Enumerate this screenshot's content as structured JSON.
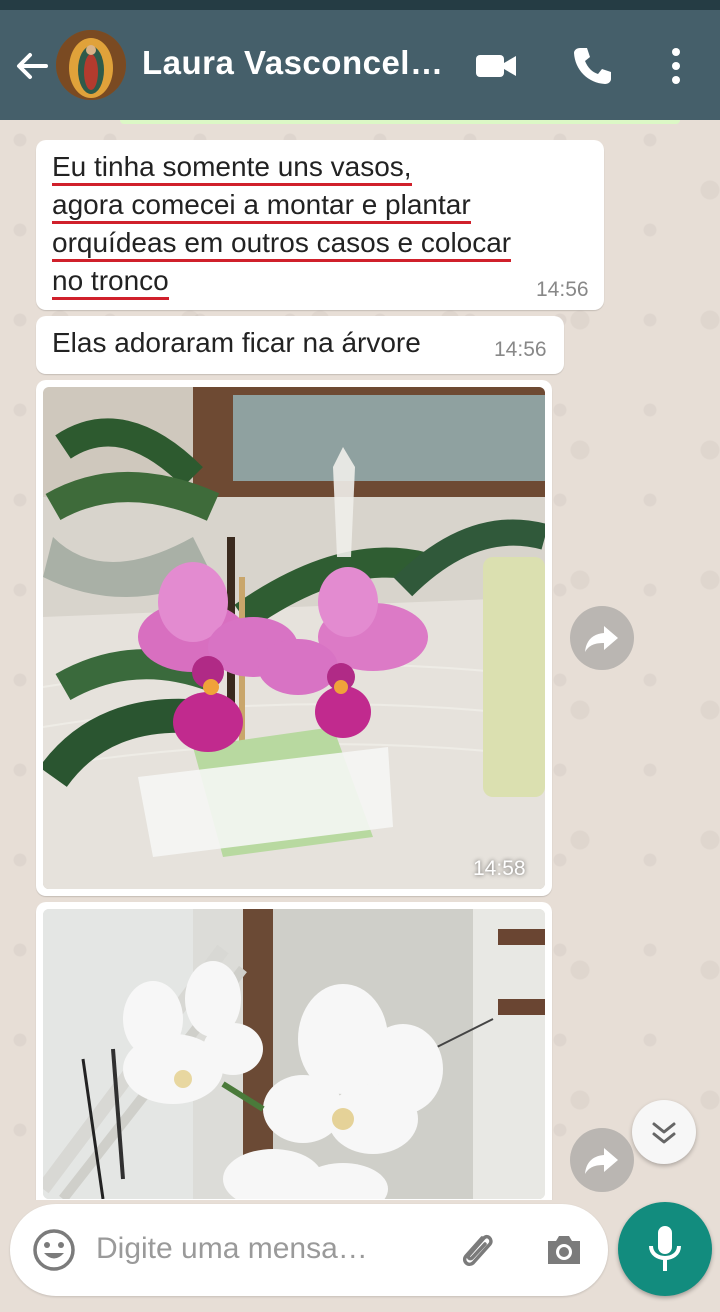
{
  "header": {
    "contact_name": "Laura Vasconcel…",
    "icons": [
      "back-arrow-icon",
      "video-call-icon",
      "phone-icon",
      "more-options-icon"
    ]
  },
  "messages": [
    {
      "lines": [
        "Eu tinha somente uns vasos,",
        "agora comecei a montar e plantar",
        "orquídeas em outros casos e colocar",
        "no tronco"
      ],
      "time": "14:56"
    },
    {
      "text": "Elas adoraram ficar na árvore",
      "time": "14:56"
    },
    {
      "type": "image",
      "subject": "pink-orchid-photo",
      "time": "14:58"
    },
    {
      "type": "image",
      "subject": "white-orchid-photo"
    }
  ],
  "composer": {
    "placeholder": "Digite uma mensa…"
  },
  "colors": {
    "header": "#455f6a",
    "status_bar": "#253c44",
    "chat_background": "#e7ded6",
    "incoming_bubble": "#ffffff",
    "fab": "#128c7e",
    "annotation_underline": "#d0202b"
  }
}
